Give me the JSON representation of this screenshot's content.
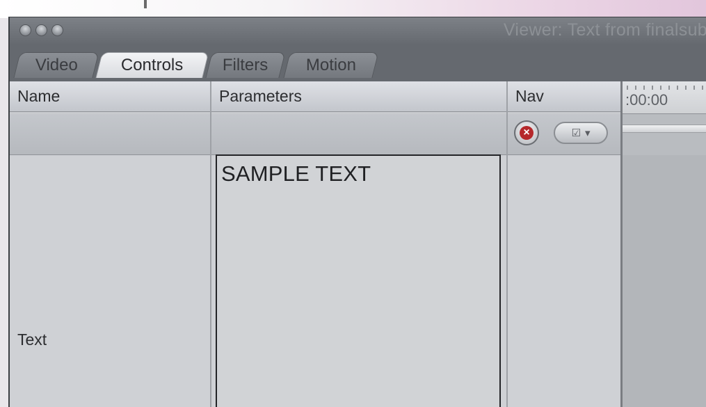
{
  "window": {
    "title": "Viewer: Text from finalsub"
  },
  "tabs": [
    {
      "label": "Video",
      "active": false
    },
    {
      "label": "Controls",
      "active": true
    },
    {
      "label": "Filters",
      "active": false
    },
    {
      "label": "Motion",
      "active": false
    }
  ],
  "columns": {
    "name": "Name",
    "parameters": "Parameters",
    "nav": "Nav"
  },
  "parameter": {
    "label": "Text",
    "value": "SAMPLE TEXT"
  },
  "timeline": {
    "timecode": ":00:00"
  },
  "icons": {
    "reset": "reset-x-icon",
    "menu": "keyframe-menu-icon",
    "chevron": "chevron-down-icon"
  },
  "colors": {
    "reset_red": "#b5282b",
    "active_tab": "#e6e7ea"
  }
}
